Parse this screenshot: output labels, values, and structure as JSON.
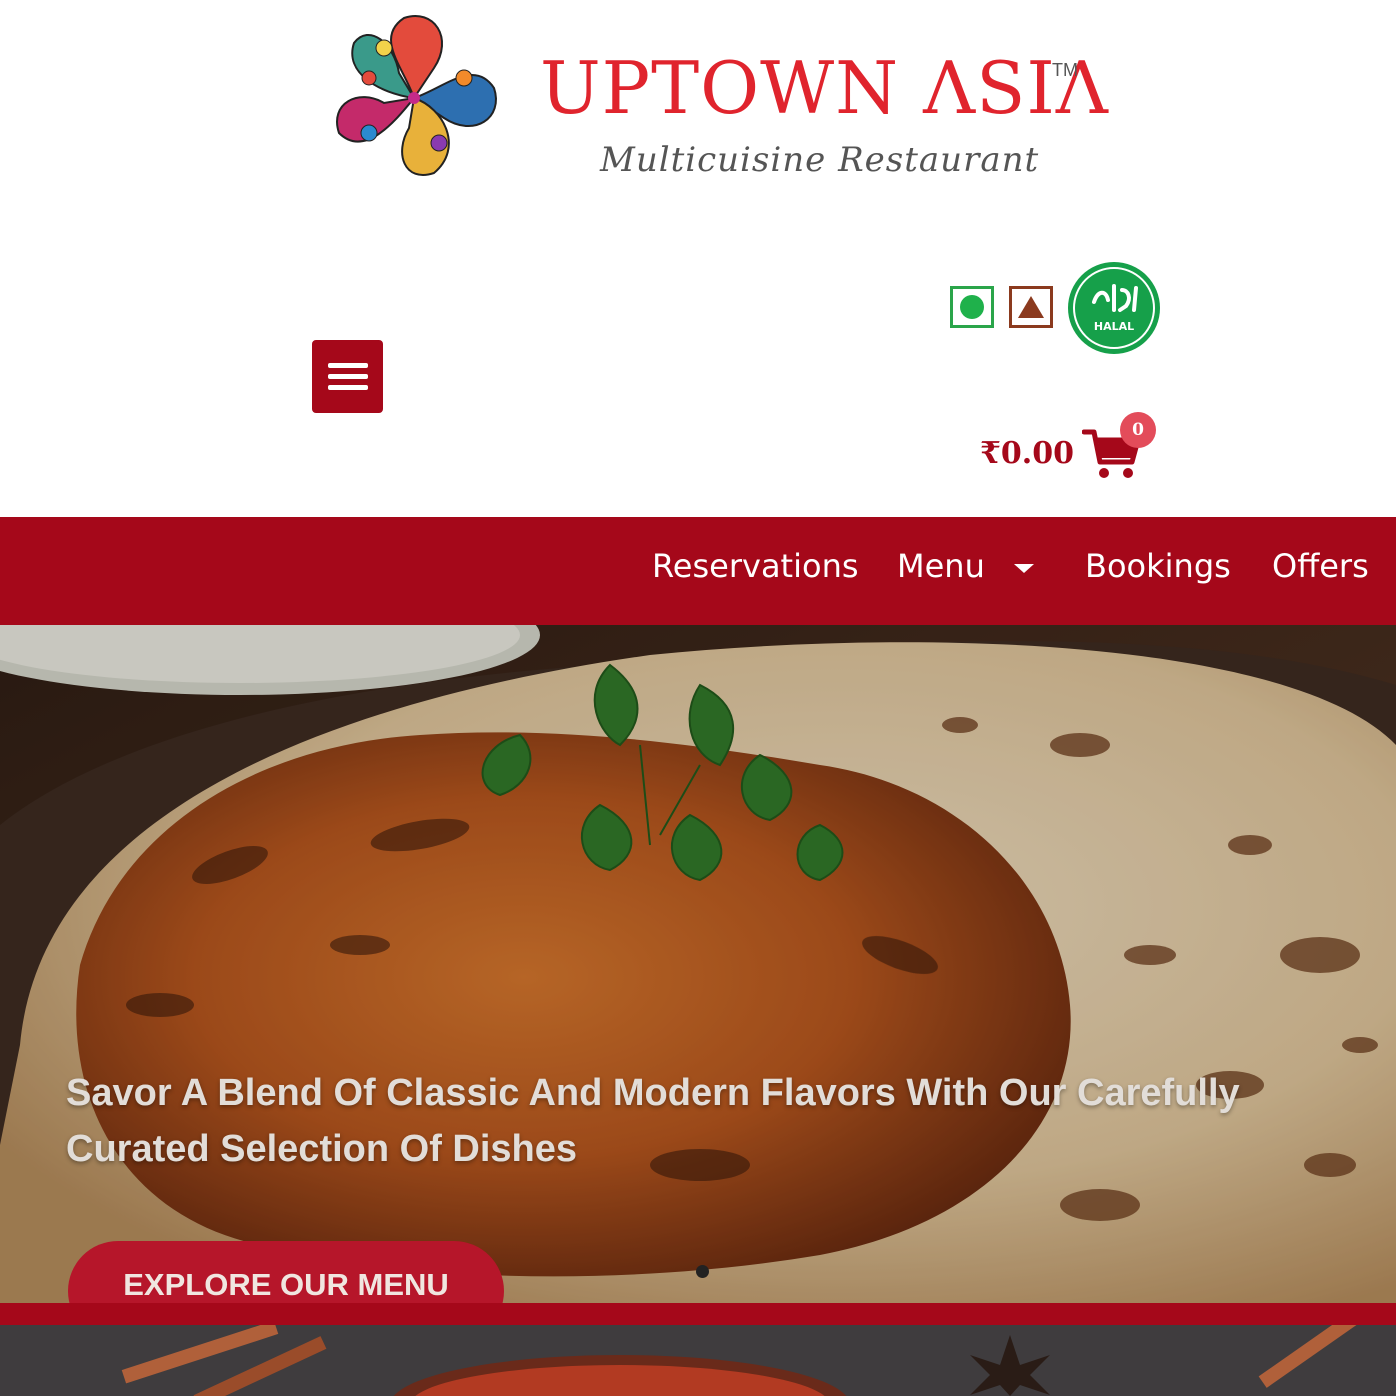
{
  "brand": {
    "name": "UPTOWN ΛSIΛ",
    "trademark": "TM",
    "tagline": "Multicuisine Restaurant"
  },
  "badges": {
    "veg_icon": "veg-indicator-icon",
    "nonveg_icon": "non-veg-indicator-icon",
    "halal_text": "HALAL"
  },
  "cart": {
    "total": "₹0.00",
    "count": "0"
  },
  "nav": {
    "items": [
      "Reservations",
      "Menu",
      "Bookings",
      "Offers"
    ]
  },
  "hero": {
    "headline": "Savor A Blend Of Classic And Modern Flavors With Our Carefully Curated Selection Of Dishes",
    "cta": "EXPLORE OUR MENU"
  },
  "colors": {
    "brand_red": "#e0242d",
    "nav_maroon": "#a5081a",
    "veg_green": "#1fb14b",
    "halal_green": "#16a04a"
  }
}
